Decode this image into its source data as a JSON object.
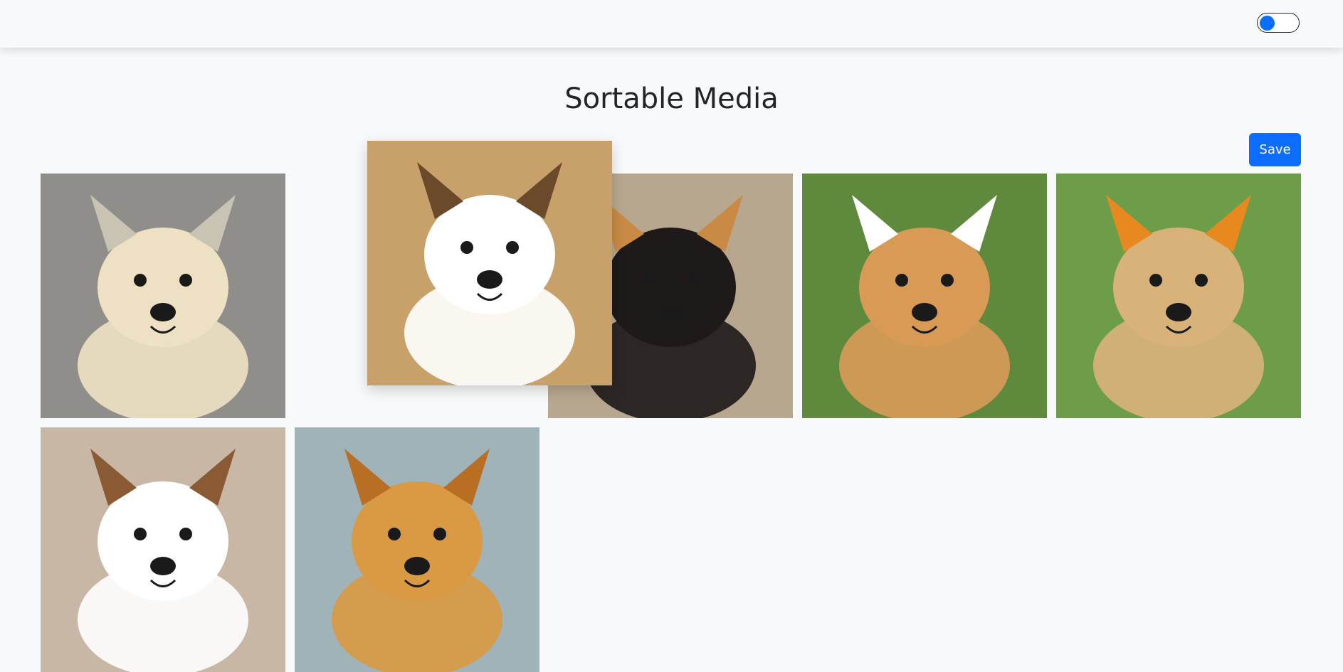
{
  "navbar": {
    "theme_toggle": {
      "checked": false
    }
  },
  "page": {
    "title": "Sortable Media",
    "save_label": "Save"
  },
  "media": [
    {
      "icon": "labrador-puppy-waving-photo",
      "bg": "#8f8e8a",
      "fur": "#eee1c3",
      "accent": "#c9c3b4"
    },
    {
      "icon": "corgi-puppy-lying-photo",
      "bg": "#c7a06a",
      "fur": "#ffffff",
      "accent": "#6b4a2b"
    },
    {
      "icon": "black-tan-puppy-photo",
      "bg": "#b8a78f",
      "fur": "#1d1a19",
      "accent": "#c98a45"
    },
    {
      "icon": "corgi-standing-grass-photo",
      "bg": "#5f8a3e",
      "fur": "#d99a56",
      "accent": "#ffffff"
    },
    {
      "icon": "golden-puppy-field-photo",
      "bg": "#6d9d49",
      "fur": "#d9b27a",
      "accent": "#e8891f"
    },
    {
      "icon": "corgi-puppy-smiling-photo",
      "bg": "#c8b7a5",
      "fur": "#ffffff",
      "accent": "#8a5a35"
    },
    {
      "icon": "golden-retriever-puppy-photo",
      "bg": "#9fb3b8",
      "fur": "#d99a43",
      "accent": "#b86f24"
    }
  ]
}
